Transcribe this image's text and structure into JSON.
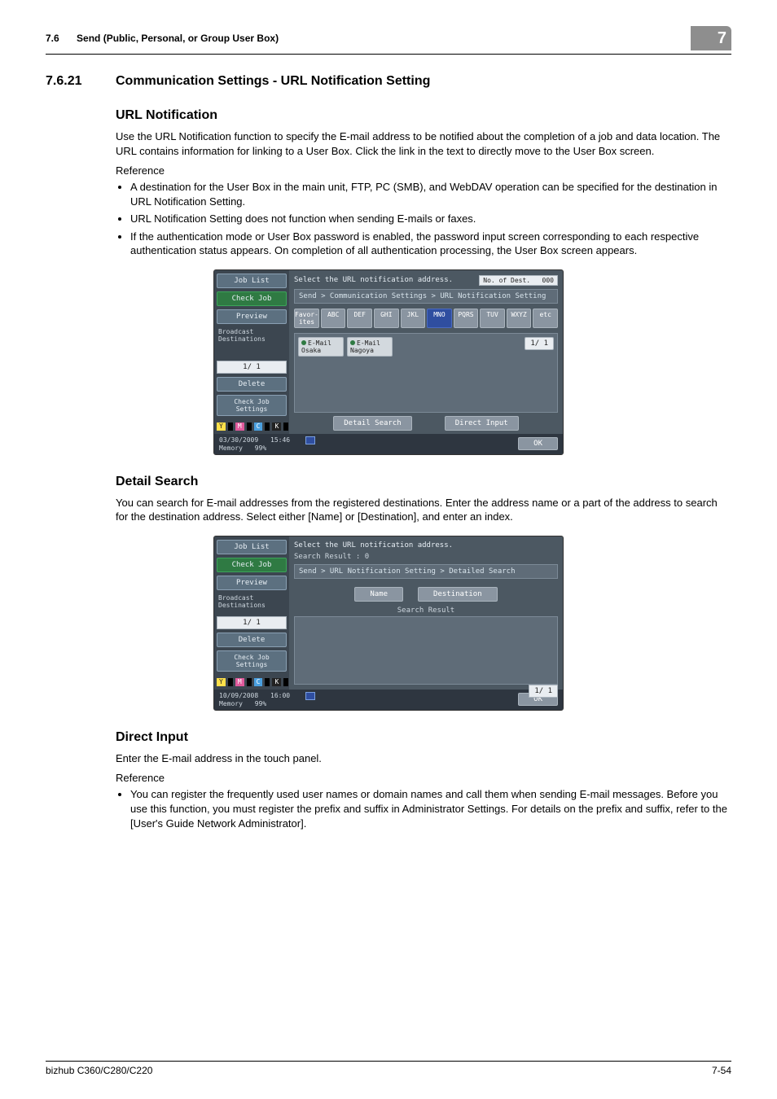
{
  "header": {
    "section_ref": "7.6",
    "section_title": "Send (Public, Personal, or Group User Box)",
    "chapter": "7"
  },
  "section": {
    "number": "7.6.21",
    "title": "Communication Settings - URL Notification Setting"
  },
  "url_notification": {
    "heading": "URL Notification",
    "intro": "Use the URL Notification function to specify the E-mail address to be notified about the completion of a job and data location. The URL contains information for linking to a User Box. Click the link in the text to directly move to the User Box screen.",
    "reference_label": "Reference",
    "bullets": [
      "A destination for the User Box in the main unit, FTP, PC (SMB), and WebDAV operation can be specified for the destination in URL Notification Setting.",
      "URL Notification Setting does not function when sending E-mails or faxes.",
      "If the authentication mode or User Box password is enabled, the password input screen corresponding to each respective authentication status appears. On completion of all authentication processing, the User Box screen appears."
    ]
  },
  "mfp1": {
    "leftpanel": {
      "job_list": "Job List",
      "check_job": "Check Job",
      "preview": "Preview",
      "broadcast": "Broadcast Destinations",
      "page": "1/ 1",
      "delete": "Delete",
      "check_settings": "Check Job Settings"
    },
    "topline": "Select the URL notification address.",
    "destcount_label": "No. of Dest.",
    "destcount_value": "000",
    "breadcrumb": "Send > Communication Settings > URL Notification Setting",
    "alpha": {
      "favor": "Favor-ites",
      "abc": "ABC",
      "def": "DEF",
      "ghi": "GHI",
      "jkl": "JKL",
      "mno": "MNO",
      "pqrs": "PQRS",
      "tuv": "TUV",
      "wxyz": "WXYZ",
      "etc": "etc"
    },
    "destinations": [
      {
        "line1": "E-Mail",
        "line2": "Osaka"
      },
      {
        "line1": "E-Mail",
        "line2": "Nagoya"
      }
    ],
    "page_indicator": "1/ 1",
    "bottom": {
      "detail": "Detail Search",
      "direct": "Direct Input"
    },
    "status": {
      "date": "03/30/2009",
      "time": "15:46",
      "mem_label": "Memory",
      "mem_val": "99%",
      "ok": "OK"
    },
    "ym": {
      "y": "Y",
      "m": "M",
      "c": "C",
      "k": "K"
    }
  },
  "detail": {
    "heading": "Detail Search",
    "body": "You can search for E-mail addresses from the registered destinations. Enter the address name or a part of the address to search for the destination address. Select either [Name] or [Destination], and enter an index."
  },
  "mfp2": {
    "leftpanel": {
      "job_list": "Job List",
      "check_job": "Check Job",
      "preview": "Preview",
      "broadcast": "Broadcast Destinations",
      "page": "1/ 1",
      "delete": "Delete",
      "check_settings": "Check Job Settings"
    },
    "topline": "Select the URL notification address.",
    "subline": "Search Result  :    0",
    "breadcrumb": "Send > URL Notification Setting > Detailed Search",
    "tabs": {
      "name": "Name",
      "dest": "Destination"
    },
    "result_title": "Search Result",
    "page_indicator": "1/ 1",
    "status": {
      "date": "10/09/2008",
      "time": "16:00",
      "mem_label": "Memory",
      "mem_val": "99%",
      "ok": "OK"
    },
    "ym": {
      "y": "Y",
      "m": "M",
      "c": "C",
      "k": "K"
    }
  },
  "direct": {
    "heading": "Direct Input",
    "body": "Enter the E-mail address in the touch panel.",
    "reference_label": "Reference",
    "bullets": [
      "You can register the frequently used user names or domain names and call them when sending E-mail messages. Before you use this function, you must register the prefix and suffix in Administrator Settings. For details on the prefix and suffix, refer to the [User's Guide Network Administrator]."
    ]
  },
  "footer": {
    "model": "bizhub C360/C280/C220",
    "page": "7-54"
  }
}
